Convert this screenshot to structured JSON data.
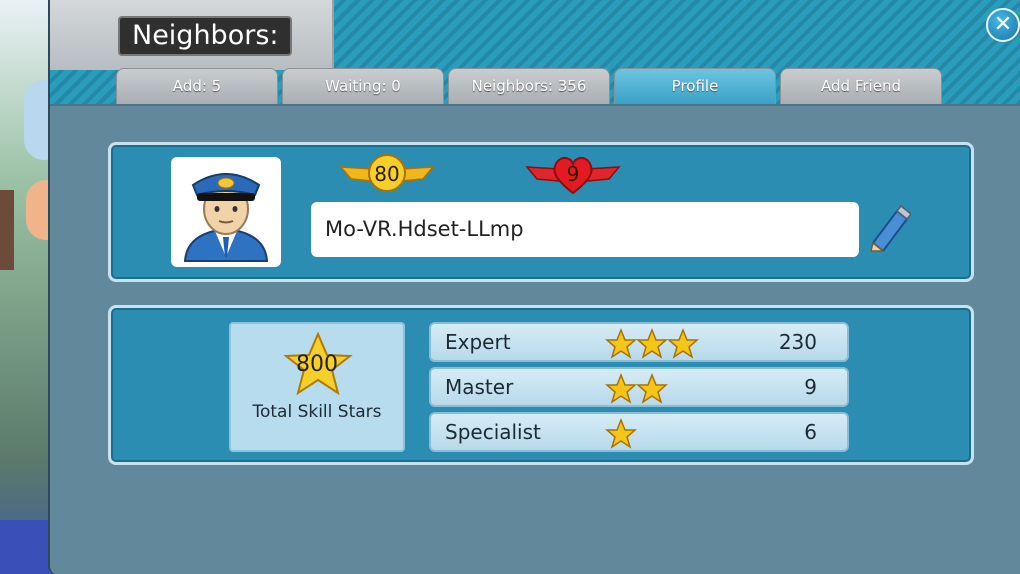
{
  "dialog": {
    "title": "Neighbors:",
    "close_label": "✕"
  },
  "tabs": [
    {
      "label": "Add: 5",
      "active": false
    },
    {
      "label": "Waiting: 0",
      "active": false
    },
    {
      "label": "Neighbors: 356",
      "active": false
    },
    {
      "label": "Profile",
      "active": true
    },
    {
      "label": "Add Friend",
      "active": false
    }
  ],
  "profile": {
    "level": "80",
    "hearts": "9",
    "name": "Mo-VR.Hdset-LLmp"
  },
  "skills": {
    "total_value": "800",
    "total_label": "Total Skill Stars",
    "rows": [
      {
        "label": "Expert",
        "stars": 3,
        "value": "230"
      },
      {
        "label": "Master",
        "stars": 2,
        "value": "9"
      },
      {
        "label": "Specialist",
        "stars": 1,
        "value": "6"
      }
    ]
  },
  "colors": {
    "accent": "#2b8db2",
    "gold": "#f5c518",
    "heart": "#d4141c"
  }
}
